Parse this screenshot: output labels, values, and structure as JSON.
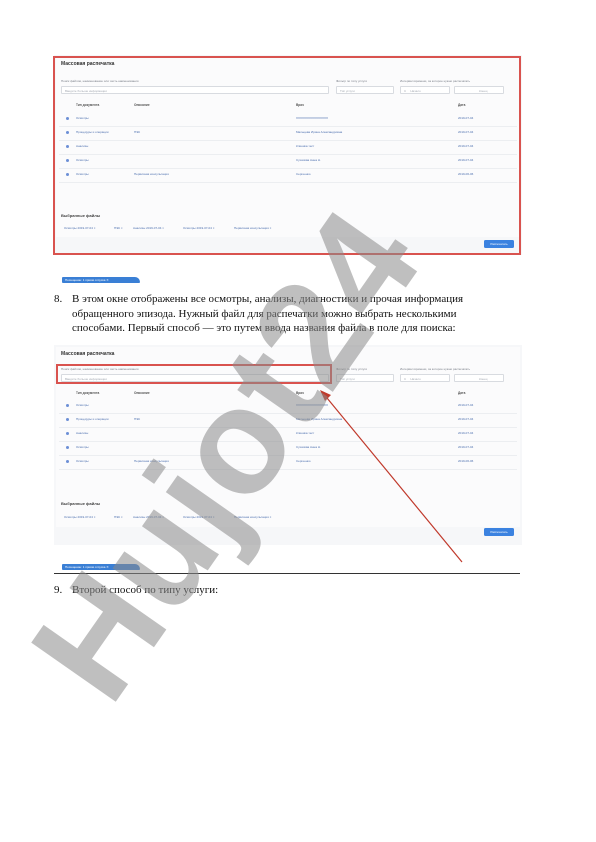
{
  "screenshot1": {
    "title": "Массовая распечатка",
    "filter_file_label": "Поиск файлов, наименование или часть наименования",
    "filter_file_placeholder": "Введите больше информации",
    "filter_type_label": "Фильтр по типу услуги",
    "filter_type_placeholder": "Тип услуги",
    "filter_date_label": "Интервал времени, за которое нужно распечатать",
    "filter_date_from": "С",
    "filter_date_from_value": "Начало",
    "filter_date_to_value": "Конец",
    "columns": [
      "Тип документа",
      "Описание",
      "Врач",
      "Дата"
    ],
    "rows": [
      {
        "type": "Осмотры",
        "desc": "",
        "doctor": "ХХХХХХХХХХХХХХХХ",
        "date": "2019-07-04"
      },
      {
        "type": "Процедуры и операции",
        "desc": "ПЭК",
        "doctor": "Мальцева Ирина Александровна",
        "date": "2019-07-04"
      },
      {
        "type": "Анализы",
        "desc": "",
        "doctor": "Клиника тест",
        "date": "2019-07-04"
      },
      {
        "type": "Осмотры",
        "desc": "",
        "doctor": "Сухачёва Анна Н.",
        "date": "2019-07-04"
      },
      {
        "type": "Осмотры",
        "desc": "Первичная консультация",
        "doctor": "Сергеенко",
        "date": "2019-06-06"
      }
    ],
    "selected_title": "Выбранные файлы",
    "selected_files": [
      "Осмотры 2019-07-04 ×",
      "ПЭК ×",
      "Анализы 2019-07-04 ×",
      "Осмотры 2019-07-04 ×",
      "Первичная консультация ×"
    ],
    "print_button": "Распечатать",
    "tab_label": "Посещение: 1 приём отпуска   ✕"
  },
  "item8": {
    "number": "8.",
    "line1": "В этом окне отображены все осмотры, анализы, диагностики и прочая информация",
    "line2": "обращенного эпизода. Нужный файл для распечатки можно выбрать несколькими",
    "line3": "способами. Первый способ — это путем ввода названия файла в поле для поиска:"
  },
  "item9": {
    "number": "9.",
    "text": "Второй способ по типу услуги:"
  },
  "watermark": {
    "text": "Hujot24",
    "color": "#8a8a8a",
    "accent": "#d9b3f5"
  },
  "colors": {
    "frame": "#d9534f",
    "button": "#3b82e0",
    "link": "#4c6fae"
  }
}
